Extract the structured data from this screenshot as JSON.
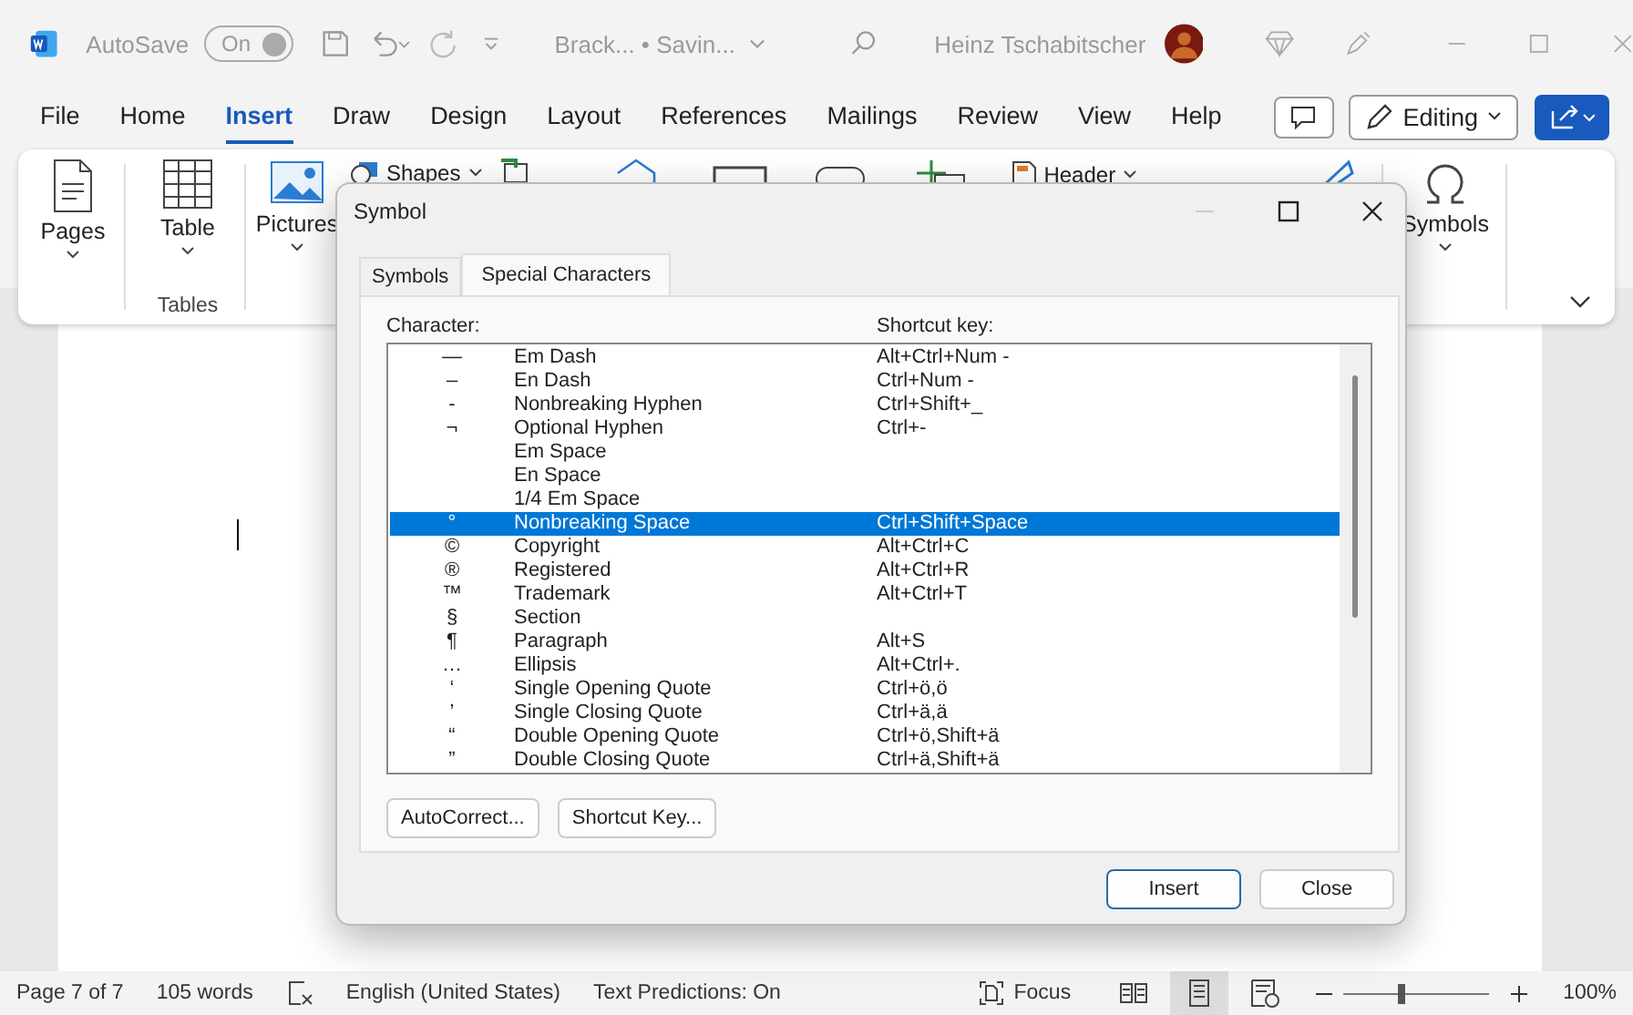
{
  "title_bar": {
    "autosave_label": "AutoSave",
    "autosave_toggle": "On",
    "document_title": "Brack...  •  Savin...",
    "user_name": "Heinz Tschabitscher"
  },
  "menu_tabs": [
    {
      "label": "File",
      "selected": false
    },
    {
      "label": "Home",
      "selected": false
    },
    {
      "label": "Insert",
      "selected": true
    },
    {
      "label": "Draw",
      "selected": false
    },
    {
      "label": "Design",
      "selected": false
    },
    {
      "label": "Layout",
      "selected": false
    },
    {
      "label": "References",
      "selected": false
    },
    {
      "label": "Mailings",
      "selected": false
    },
    {
      "label": "Review",
      "selected": false
    },
    {
      "label": "View",
      "selected": false
    },
    {
      "label": "Help",
      "selected": false
    }
  ],
  "editing_button": "Editing",
  "ribbon": {
    "pages": "Pages",
    "table": "Table",
    "tables_group": "Tables",
    "pictures": "Pictures",
    "shapes": "Shapes",
    "header": "Header",
    "symbols": "Symbols"
  },
  "dialog": {
    "title": "Symbol",
    "tabs": [
      {
        "label": "Symbols",
        "selected": false
      },
      {
        "label": "Special Characters",
        "selected": true
      }
    ],
    "columns": [
      "Character:",
      "Shortcut key:"
    ],
    "rows": [
      {
        "char": "—",
        "name": "Em Dash",
        "shortcut": "Alt+Ctrl+Num -",
        "selected": false
      },
      {
        "char": "–",
        "name": "En Dash",
        "shortcut": "Ctrl+Num -",
        "selected": false
      },
      {
        "char": "-",
        "name": "Nonbreaking Hyphen",
        "shortcut": "Ctrl+Shift+_",
        "selected": false
      },
      {
        "char": "¬",
        "name": "Optional Hyphen",
        "shortcut": "Ctrl+-",
        "selected": false
      },
      {
        "name": "Em Space",
        "selected": false
      },
      {
        "name": "En Space",
        "selected": false
      },
      {
        "name": "1/4 Em Space",
        "selected": false
      },
      {
        "char": "°",
        "name": "Nonbreaking Space",
        "shortcut": "Ctrl+Shift+Space",
        "selected": true
      },
      {
        "char": "©",
        "name": "Copyright",
        "shortcut": "Alt+Ctrl+C",
        "selected": false
      },
      {
        "char": "®",
        "name": "Registered",
        "shortcut": "Alt+Ctrl+R",
        "selected": false
      },
      {
        "char": "™",
        "name": "Trademark",
        "shortcut": "Alt+Ctrl+T",
        "selected": false
      },
      {
        "char": "§",
        "name": "Section",
        "selected": false
      },
      {
        "char": "¶",
        "name": "Paragraph",
        "shortcut": "Alt+S",
        "selected": false
      },
      {
        "char": "…",
        "name": "Ellipsis",
        "shortcut": "Alt+Ctrl+.",
        "selected": false
      },
      {
        "char": "‘",
        "name": "Single Opening Quote",
        "shortcut": "Ctrl+ö,ö",
        "selected": false
      },
      {
        "char": "’",
        "name": "Single Closing Quote",
        "shortcut": "Ctrl+ä,ä",
        "selected": false
      },
      {
        "char": "“",
        "name": "Double Opening Quote",
        "shortcut": "Ctrl+ö,Shift+ä",
        "selected": false
      },
      {
        "char": "”",
        "name": "Double Closing Quote",
        "shortcut": "Ctrl+ä,Shift+ä",
        "selected": false
      }
    ],
    "buttons": [
      "AutoCorrect...",
      "Shortcut Key..."
    ],
    "footer_buttons": [
      {
        "label": "Insert",
        "default": true
      },
      {
        "label": "Close",
        "default": false
      }
    ]
  },
  "status_bar": {
    "page": "Page 7 of 7",
    "words": "105 words",
    "language": "English (United States)",
    "text_predictions": "Text Predictions: On",
    "focus": "Focus",
    "views": [
      {
        "kind": "read",
        "selected": false
      },
      {
        "kind": "print",
        "selected": true
      },
      {
        "kind": "web",
        "selected": false
      }
    ],
    "zoom": {
      "level": 0.4,
      "reading": "100%"
    }
  }
}
